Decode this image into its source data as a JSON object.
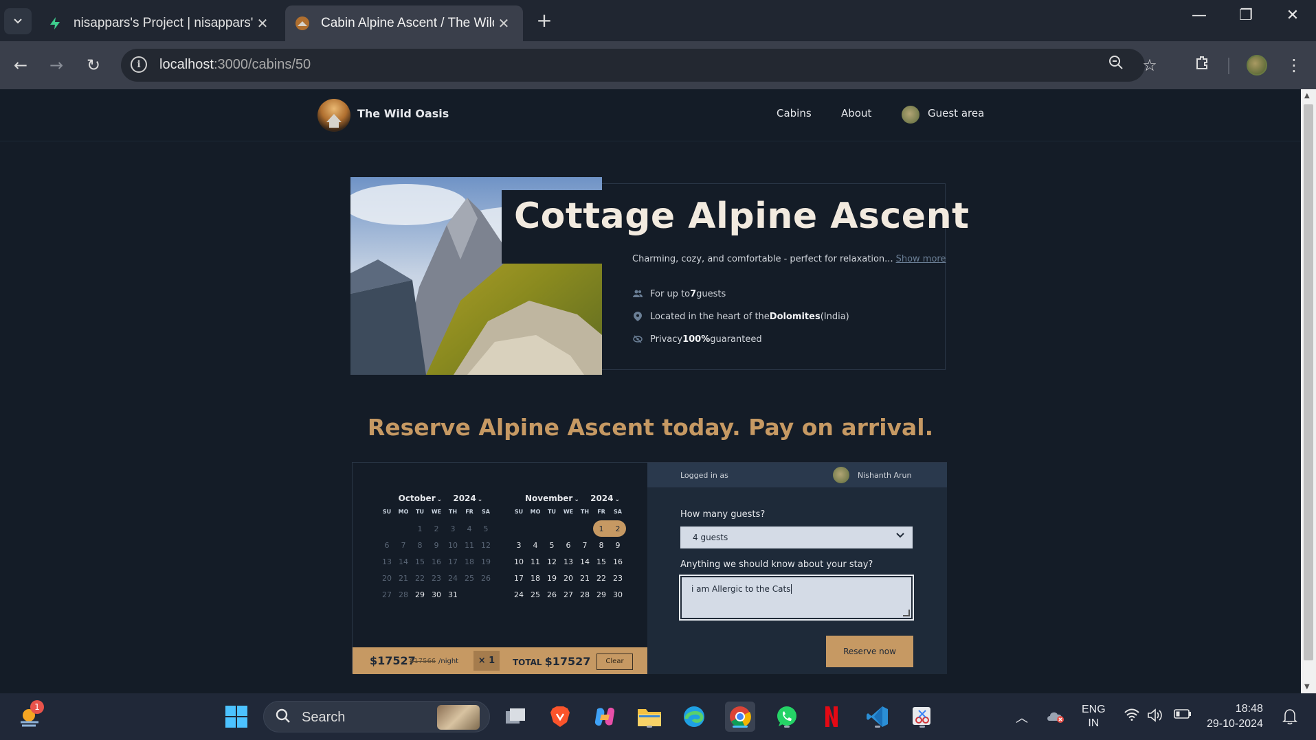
{
  "browser": {
    "tabs": [
      {
        "title": "nisappars's Project | nisappars's",
        "favicon": "supabase-icon"
      },
      {
        "title": "Cabin Alpine Ascent / The Wild",
        "favicon": "wild-oasis-logo-icon"
      }
    ],
    "url_host": "localhost",
    "url_path": ":3000/cabins/50"
  },
  "site": {
    "brand": "The Wild Oasis",
    "nav": {
      "cabins": "Cabins",
      "about": "About",
      "guest_area": "Guest area"
    }
  },
  "cabin": {
    "title": "Cottage Alpine Ascent",
    "description": "Charming, cozy, and comfortable - perfect for relaxation...",
    "show_more": "Show more",
    "features": {
      "guests_pre": "For up to ",
      "guests_num": "7",
      "guests_post": " guests",
      "loc_pre": "Located in the heart of the ",
      "loc_bold": "Dolomites",
      "loc_post": " (India)",
      "privacy_pre": "Privacy ",
      "privacy_bold": "100%",
      "privacy_post": " guaranteed"
    }
  },
  "reserve": {
    "heading": "Reserve Alpine Ascent today. Pay on arrival.",
    "calendar": {
      "weekdays": [
        "SU",
        "MO",
        "TU",
        "WE",
        "TH",
        "FR",
        "SA"
      ],
      "months": [
        {
          "month": "October",
          "year": "2024",
          "offset": 2,
          "days": 31,
          "past_through": 28
        },
        {
          "month": "November",
          "year": "2024",
          "offset": 5,
          "days": 30,
          "past_through": 0,
          "selected": [
            1,
            2
          ]
        }
      ]
    },
    "price": {
      "current": "$17527",
      "old": "$17566",
      "per_night": "/night",
      "nights": "× 1",
      "total_label": "TOTAL",
      "total": "$17527",
      "clear": "Clear"
    },
    "form": {
      "logged_in_as": "Logged in as",
      "user_name": "Nishanth Arun",
      "guests_label": "How many guests?",
      "guests_value": "4 guests",
      "notes_label": "Anything we should know about your stay?",
      "notes_value": "i am Allergic to the Cats",
      "submit": "Reserve now"
    }
  },
  "taskbar": {
    "search": "Search",
    "notification_count": "1",
    "lang_line1": "ENG",
    "lang_line2": "IN",
    "time": "18:48",
    "date": "29-10-2024"
  },
  "colors": {
    "accent": "#c69963",
    "bg": "#141c27",
    "panel": "#1e2a39"
  }
}
